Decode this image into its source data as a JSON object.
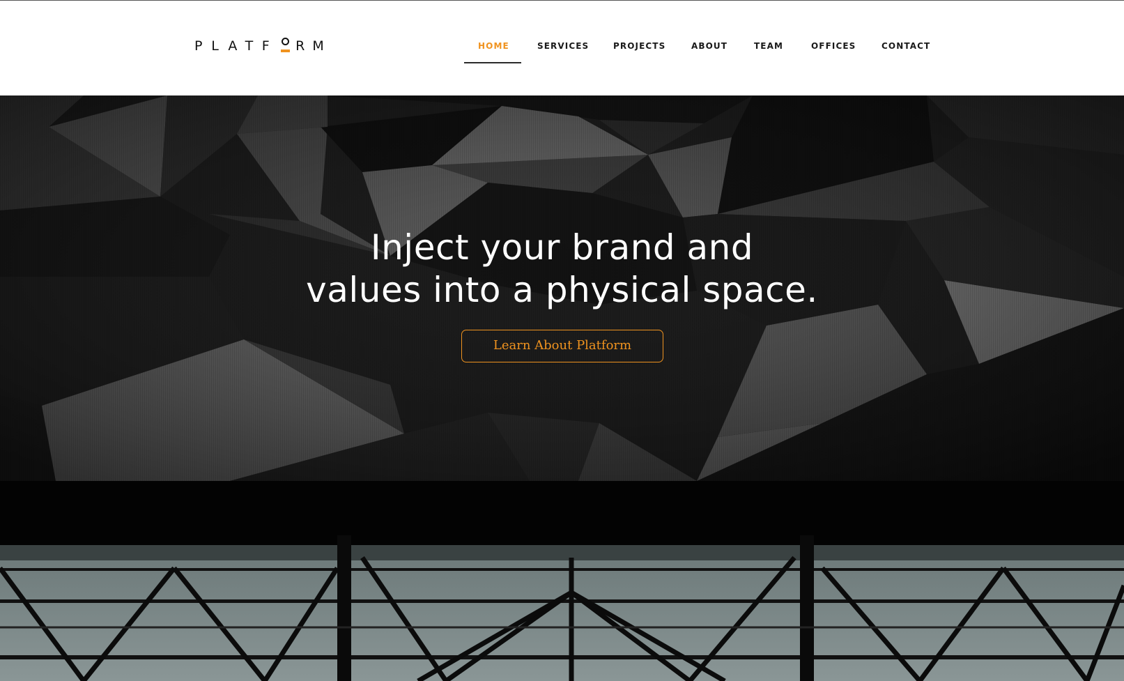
{
  "brand": {
    "letters_before": [
      "P",
      "L",
      "A",
      "T",
      "F"
    ],
    "letters_after": [
      "R",
      "M"
    ],
    "accent_color": "#f0931f"
  },
  "nav": {
    "items": [
      {
        "label": "HOME",
        "active": true
      },
      {
        "label": "SERVICES",
        "active": false
      },
      {
        "label": "PROJECTS",
        "active": false
      },
      {
        "label": "ABOUT",
        "active": false
      },
      {
        "label": "TEAM",
        "active": false
      },
      {
        "label": "OFFICES",
        "active": false
      },
      {
        "label": "CONTACT",
        "active": false
      }
    ]
  },
  "hero": {
    "title_line1": "Inject your brand and",
    "title_line2": "values into a physical space.",
    "cta_label": "Learn About Platform",
    "background_image": "dark low-poly geometric ceiling"
  },
  "lower_section": {
    "background_image": "steel truss roof structure"
  }
}
